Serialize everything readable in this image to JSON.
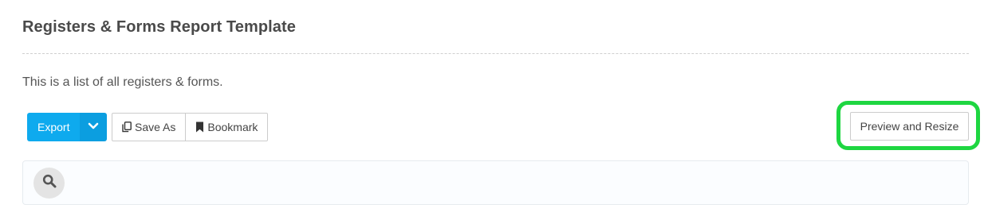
{
  "header": {
    "title": "Registers & Forms Report Template",
    "description": "This is a list of all registers & forms."
  },
  "toolbar": {
    "export_label": "Export",
    "export_icon": "chevron-down-icon",
    "save_as_label": "Save As",
    "save_as_icon": "copy-icon",
    "bookmark_label": "Bookmark",
    "bookmark_icon": "bookmark-icon",
    "preview_resize_label": "Preview and Resize"
  },
  "search": {
    "icon": "search-icon"
  },
  "colors": {
    "accent": "#0eaaee",
    "highlight": "#1ed641"
  }
}
